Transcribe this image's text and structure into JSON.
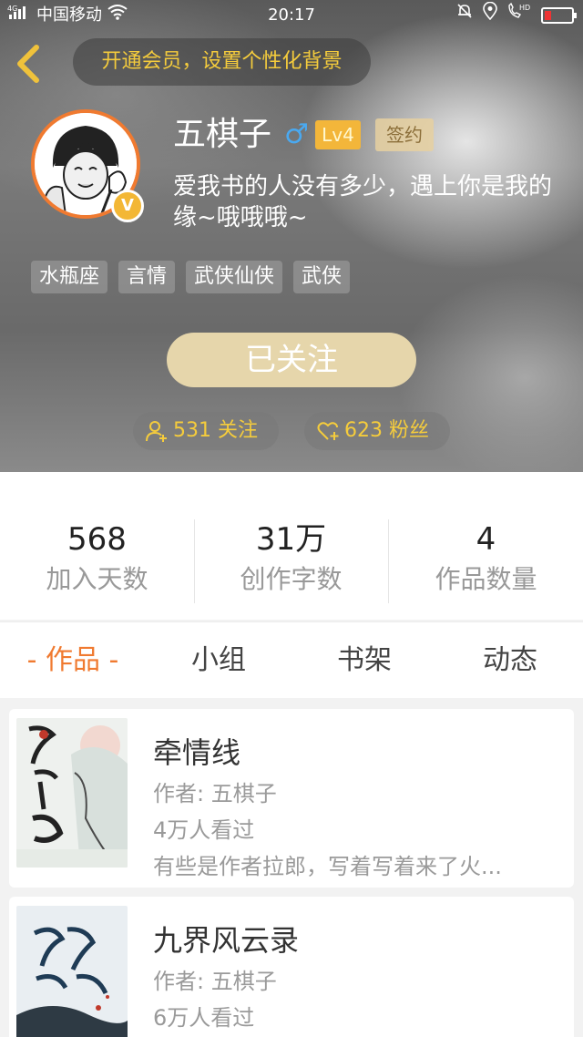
{
  "status_bar": {
    "signal": "4G",
    "carrier": "中国移动",
    "time": "20:17",
    "volte": "HD"
  },
  "header": {
    "member_banner": "开通会员，设置个性化背景",
    "name": "五棋子",
    "gender_symbol": "♂",
    "level": "Lv4",
    "signed_badge": "签约",
    "verified_badge": "V",
    "motto": "爱我书的人没有多少，遇上你是我的缘~哦哦哦~",
    "tags": [
      "水瓶座",
      "言情",
      "武侠仙侠",
      "武侠"
    ],
    "follow_button": "已关注",
    "following": "531 关注",
    "fans": "623 粉丝"
  },
  "stats": [
    {
      "value": "568",
      "label": "加入天数"
    },
    {
      "value": "31万",
      "label": "创作字数"
    },
    {
      "value": "4",
      "label": "作品数量"
    }
  ],
  "tabs": [
    {
      "label": "作品",
      "active": true
    },
    {
      "label": "小组",
      "active": false
    },
    {
      "label": "书架",
      "active": false
    },
    {
      "label": "动态",
      "active": false
    }
  ],
  "books": [
    {
      "title": "牵情线",
      "author": "作者: 五棋子",
      "views": "4万人看过",
      "description": "有些是作者拉郎，写着写着来了火..."
    },
    {
      "title": "九界风云录",
      "author": "作者: 五棋子",
      "views": "6万人看过",
      "description": ""
    }
  ],
  "colors": {
    "accent": "#f07a30",
    "gold": "#f5cc3c",
    "level_badge": "#f3b63a",
    "follow_button": "#e6d6ab"
  }
}
